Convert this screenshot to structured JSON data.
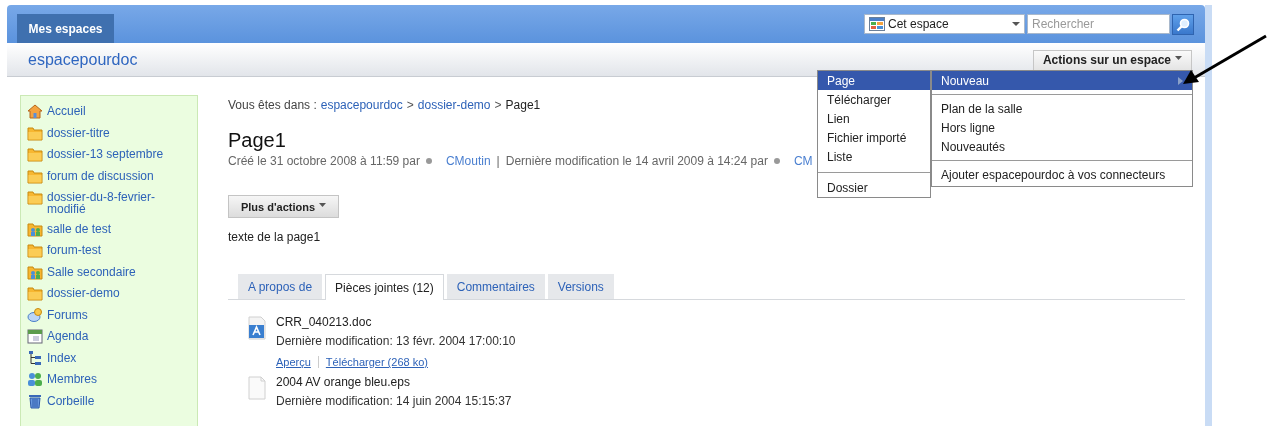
{
  "header": {
    "tab": "Mes espaces",
    "scope": "Cet espace",
    "search_placeholder": "Rechercher"
  },
  "space_title": "espacepourdoc",
  "space_actions": "Actions sur un espace",
  "sidebar": {
    "items": [
      {
        "label": "Accueil",
        "kind": "home"
      },
      {
        "label": "dossier-titre",
        "kind": "folder"
      },
      {
        "label": "dossier-13 septembre",
        "kind": "folder"
      },
      {
        "label": "forum de discussion",
        "kind": "folder"
      },
      {
        "label": "dossier-du-8-fevrier-modifié",
        "kind": "folder"
      },
      {
        "label": "salle de test",
        "kind": "room"
      },
      {
        "label": "forum-test",
        "kind": "folder"
      },
      {
        "label": "Salle secondaire",
        "kind": "room"
      },
      {
        "label": "dossier-demo",
        "kind": "folder"
      },
      {
        "label": "Forums",
        "kind": "forum"
      },
      {
        "label": "Agenda",
        "kind": "agenda"
      },
      {
        "label": "Index",
        "kind": "index"
      },
      {
        "label": "Membres",
        "kind": "members"
      },
      {
        "label": "Corbeille",
        "kind": "trash"
      }
    ]
  },
  "breadcrumb": [
    {
      "label": "Vous êtes dans :",
      "kind": "text"
    },
    {
      "label": "espacepourdoc",
      "kind": "link"
    },
    {
      "label": ">",
      "kind": "sep"
    },
    {
      "label": "dossier-demo",
      "kind": "link"
    },
    {
      "label": ">",
      "kind": "sep"
    },
    {
      "label": "Page1",
      "kind": "text"
    }
  ],
  "page": {
    "title": "Page1",
    "meta": [
      {
        "label": "Créé le 31 octobre 2008 à 11:59 par",
        "kind": "text"
      },
      {
        "kind": "dot"
      },
      {
        "label": "CMoutin",
        "kind": "link"
      },
      {
        "label": "|",
        "kind": "sep"
      },
      {
        "label": "Dernière modification le 14 avril 2009 à 14:24 par",
        "kind": "text"
      },
      {
        "kind": "dot"
      },
      {
        "label": "CM",
        "kind": "link"
      }
    ],
    "more_actions": "Plus d'actions",
    "body": "texte de la page1"
  },
  "tabs": [
    {
      "label": "A propos de",
      "selected": false
    },
    {
      "label": "Pièces jointes (12)",
      "selected": true
    },
    {
      "label": "Commentaires",
      "selected": false
    },
    {
      "label": "Versions",
      "selected": false
    }
  ],
  "attachments": [
    {
      "name": "CRR_040213.doc",
      "kind": "doc",
      "modified": "Dernière modification: 13 févr. 2004 17:00:10",
      "links": [
        "Aperçu",
        "Télécharger (268 ko)"
      ]
    },
    {
      "name": "2004 AV orange bleu.eps",
      "kind": "file",
      "modified": "Dernière modification: 14 juin 2004 15:15:37"
    }
  ],
  "menus": [
    {
      "groups": [
        [
          {
            "label": "Page",
            "selected": true
          },
          {
            "label": "Télécharger",
            "selected": false
          },
          {
            "label": "Lien",
            "selected": false
          },
          {
            "label": "Fichier importé",
            "selected": false
          },
          {
            "label": "Liste",
            "selected": false
          }
        ],
        [
          {
            "label": "Dossier",
            "selected": false
          }
        ]
      ]
    },
    {
      "groups": [
        [
          {
            "label": "Nouveau",
            "selected": true,
            "submenu": true
          }
        ],
        [
          {
            "label": "Plan de la salle",
            "selected": false
          },
          {
            "label": "Hors ligne",
            "selected": false
          },
          {
            "label": "Nouveautés",
            "selected": false
          }
        ],
        [
          {
            "label": "Ajouter espacepourdoc à vos connecteurs",
            "selected": false
          }
        ]
      ]
    }
  ]
}
